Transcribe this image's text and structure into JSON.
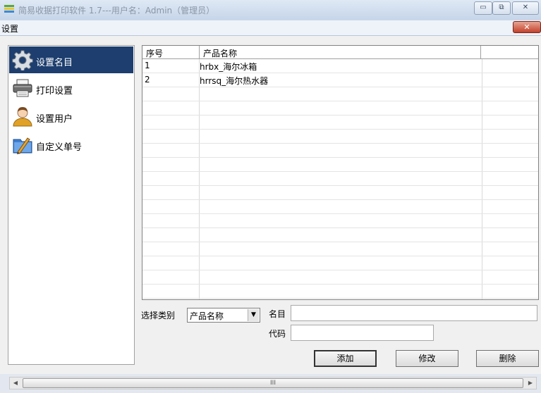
{
  "window": {
    "title": "简易收据打印软件 1.7---用户名：Admin（管理员）",
    "minimize_glyph": "▭",
    "restore_glyph": "⧉",
    "close_glyph": "✕"
  },
  "dialog": {
    "title": "设置",
    "close_glyph": "✕"
  },
  "nav": {
    "items": [
      {
        "label": "设置名目",
        "icon": "gear-icon",
        "active": true
      },
      {
        "label": "打印设置",
        "icon": "printer-icon",
        "active": false
      },
      {
        "label": "设置用户",
        "icon": "user-icon",
        "active": false
      },
      {
        "label": "自定义单号",
        "icon": "pen-folder-icon",
        "active": false
      }
    ]
  },
  "grid": {
    "columns": [
      "序号",
      "产品名称",
      ""
    ],
    "rows": [
      {
        "no": "1",
        "name": "hrbx_海尔冰箱"
      },
      {
        "no": "2",
        "name": "hrrsq_海尔热水器"
      }
    ]
  },
  "form": {
    "category_label": "选择类别",
    "category_value": "产品名称",
    "name_label": "名目",
    "name_value": "",
    "code_label": "代码",
    "code_value": ""
  },
  "buttons": {
    "add": "添加",
    "edit": "修改",
    "delete": "删除"
  },
  "scrollbar": {
    "grip": "III",
    "left_arrow": "◀",
    "right_arrow": "▶"
  },
  "colors": {
    "selected_nav_bg": "#1d3e6e",
    "title_bar": "#cfdcee",
    "close_button": "#c2412b"
  }
}
